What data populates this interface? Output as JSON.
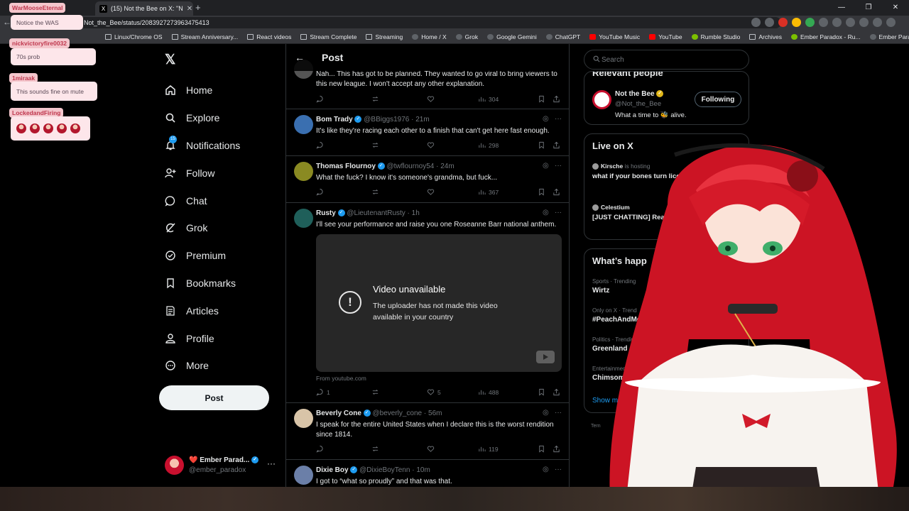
{
  "browser": {
    "tab_title": "(15) Not the Bee on X: \"N",
    "tab_icon": "X",
    "url": "Not_the_Bee/status/2083927273963475413",
    "bookmarks": [
      "Linux/Chrome OS",
      "Stream Anniversary...",
      "React videos",
      "Stream Complete",
      "Streaming",
      "Home / X",
      "Grok",
      "Google Gemini",
      "ChatGPT",
      "YouTube Music",
      "YouTube",
      "Rumble Studio",
      "Archives",
      "Ember Paradox - Ru...",
      "Ember Paradox"
    ]
  },
  "nav": {
    "items": [
      {
        "label": "Home",
        "icon": "home-icon"
      },
      {
        "label": "Explore",
        "icon": "search-icon"
      },
      {
        "label": "Notifications",
        "icon": "bell-icon",
        "badge": "15"
      },
      {
        "label": "Follow",
        "icon": "person-add-icon"
      },
      {
        "label": "Chat",
        "icon": "chat-icon"
      },
      {
        "label": "Grok",
        "icon": "grok-icon"
      },
      {
        "label": "Premium",
        "icon": "premium-icon"
      },
      {
        "label": "Bookmarks",
        "icon": "bookmark-icon"
      },
      {
        "label": "Articles",
        "icon": "article-icon"
      },
      {
        "label": "Profile",
        "icon": "profile-icon"
      },
      {
        "label": "More",
        "icon": "more-circle-icon"
      }
    ],
    "post_label": "Post",
    "account": {
      "name": "Ember Parad...",
      "handle": "@ember_paradox"
    }
  },
  "thread": {
    "header_title": "Post",
    "replies": [
      {
        "name": "",
        "handle": "",
        "time": "",
        "text": "Nah... This has got to be planned. They wanted to go viral to bring viewers to this new league. I won't accept any other explanation.",
        "replies": "",
        "likes": "",
        "views": "304"
      },
      {
        "name": "Bom Trady",
        "handle": "@BBiggs1976",
        "time": "21m",
        "text": "It's like they're racing each other to a finish that can't get here fast enough.",
        "replies": "",
        "likes": "",
        "views": "298"
      },
      {
        "name": "Thomas Flournoy",
        "handle": "@twflournoy54",
        "time": "24m",
        "text": "What the fuck? I know it's someone's grandma, but fuck...",
        "replies": "",
        "likes": "",
        "views": "367"
      },
      {
        "name": "Rusty",
        "handle": "@LieutenantRusty",
        "time": "1h",
        "text": "I'll see your performance and raise you one Roseanne Barr national anthem.",
        "replies": "1",
        "likes": "5",
        "views": "488"
      },
      {
        "name": "Beverly Cone",
        "handle": "@beverly_cone",
        "time": "56m",
        "text": "I speak for the entire United States when I declare this is the worst rendition since 1814.",
        "replies": "",
        "likes": "",
        "views": "119"
      },
      {
        "name": "Dixie Boy",
        "handle": "@DixieBoyTenn",
        "time": "10m",
        "text": "I got to “what so proudly” and that was that.",
        "replies": "",
        "likes": "",
        "views": ""
      }
    ],
    "video": {
      "title": "Video unavailable",
      "subtitle": "The uploader has not made this video available in your country",
      "source": "From youtube.com"
    }
  },
  "right": {
    "search_placeholder": "Search",
    "relevant_title": "Relevant people",
    "relevant": {
      "name": "Not the Bee",
      "handle": "@Not_the_Bee",
      "bio": "What a time to 🐝 alive.",
      "button": "Following"
    },
    "live_title": "Live on X",
    "live": [
      {
        "host": "Kirsche",
        "sub": "is hosting",
        "title": "what if your bones turn licorice"
      },
      {
        "host": "Celestium",
        "sub": "",
        "title": "[JUST CHATTING] Reading + Reacts"
      }
    ],
    "whats_title": "What’s happ",
    "trends": [
      {
        "category": "Sports · Trending",
        "name": "Wirtz"
      },
      {
        "category": "Only on X · Trend",
        "name": "#PeachAndMe"
      },
      {
        "category": "Politics · Trending",
        "name": "Greenland"
      },
      {
        "category": "Entertainment",
        "name": "Chimsom"
      }
    ],
    "show_more": "Show m",
    "terms": "Tern"
  },
  "chat": [
    {
      "user": "WarMooseEternal",
      "message": "Notice the WAS"
    },
    {
      "user": "nickvictoryfire0032",
      "message": "70s prob"
    },
    {
      "user": "1miraak",
      "message": "This sounds fine on mute"
    },
    {
      "user": "LockedandFiring",
      "message": ""
    }
  ],
  "colors": {
    "accent": "#1d9bf0",
    "background": "#000000",
    "chat_name": "#c0394f",
    "avatar_hair": "#d11a2a"
  }
}
